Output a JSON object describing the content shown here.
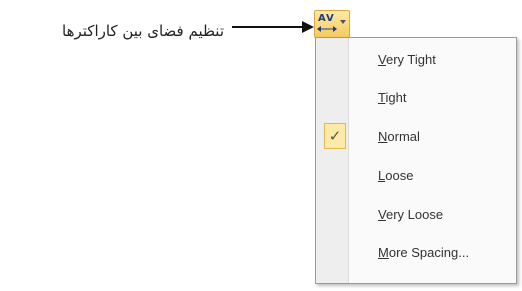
{
  "annotation": {
    "label": "تنظیم فضای بین کاراکترها"
  },
  "toolbar": {
    "spacing_button_text": "AV",
    "spacing_button_icon": "character-spacing-icon"
  },
  "menu": {
    "items": [
      {
        "label": "Very Tight",
        "checked": false
      },
      {
        "label": "Tight",
        "checked": false
      },
      {
        "label": "Normal",
        "checked": true
      },
      {
        "label": "Loose",
        "checked": false
      },
      {
        "label": "Very Loose",
        "checked": false
      },
      {
        "label": "More Spacing...",
        "checked": false
      }
    ],
    "check_glyph": "✓"
  },
  "colors": {
    "highlight": "#fde9a8",
    "highlight_border": "#e2b84f"
  }
}
